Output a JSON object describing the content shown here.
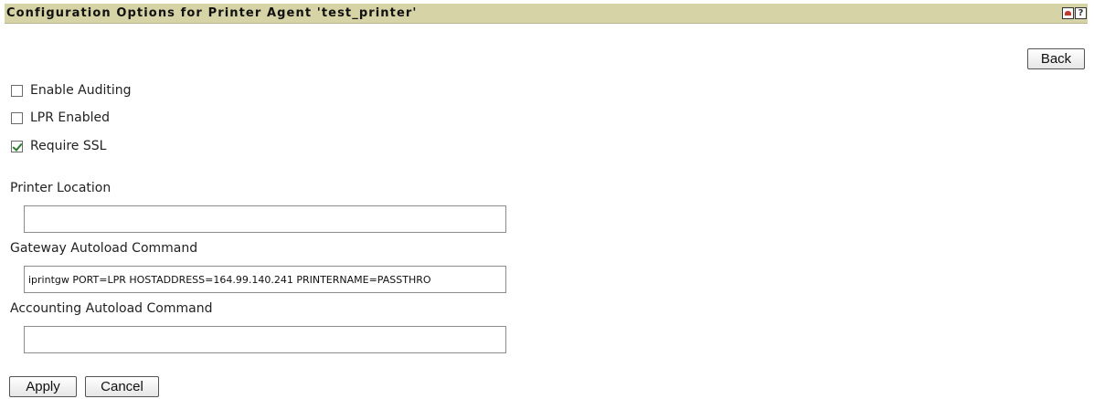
{
  "header": {
    "title": "Configuration Options for Printer Agent 'test_printer'",
    "home_icon": "home-icon",
    "help_icon": "help-icon",
    "help_glyph": "?",
    "bar_color": "#d6d3a6"
  },
  "toolbar": {
    "back_label": "Back"
  },
  "options": {
    "enable_auditing": {
      "label": "Enable Auditing",
      "checked": false
    },
    "lpr_enabled": {
      "label": "LPR Enabled",
      "checked": false
    },
    "require_ssl": {
      "label": "Require SSL",
      "checked": true
    }
  },
  "fields": {
    "printer_location": {
      "label": "Printer Location",
      "value": ""
    },
    "gateway_autoload": {
      "label": "Gateway Autoload Command",
      "value": "iprintgw PORT=LPR HOSTADDRESS=164.99.140.241 PRINTERNAME=PASSTHRO"
    },
    "accounting_autoload": {
      "label": "Accounting Autoload Command",
      "value": ""
    }
  },
  "actions": {
    "apply_label": "Apply",
    "cancel_label": "Cancel"
  }
}
